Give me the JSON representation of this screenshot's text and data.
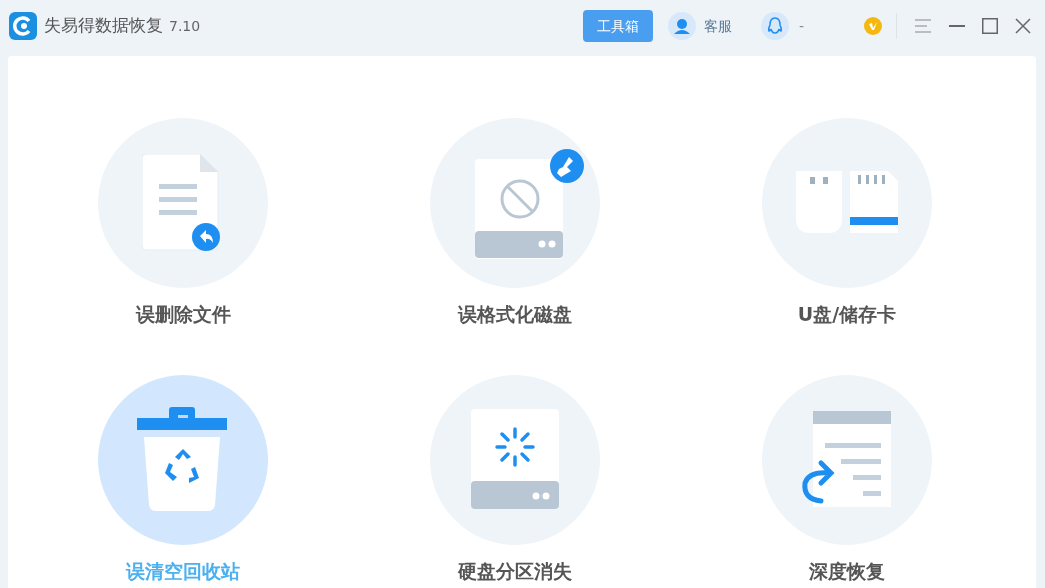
{
  "app": {
    "title": "失易得数据恢复",
    "version": "7.10"
  },
  "toolbar": {
    "toolbox_button": "工具箱",
    "service": "客服",
    "qq": "-"
  },
  "tiles": [
    {
      "kind": "file",
      "label": "误删除文件",
      "selected": false
    },
    {
      "kind": "format",
      "label": "误格式化磁盘",
      "selected": false
    },
    {
      "kind": "usb",
      "label": "U盘/储存卡",
      "selected": false
    },
    {
      "kind": "recycle",
      "label": "误清空回收站",
      "selected": true
    },
    {
      "kind": "partition",
      "label": "硬盘分区消失",
      "selected": false
    },
    {
      "kind": "deep",
      "label": "深度恢复",
      "selected": false
    }
  ]
}
